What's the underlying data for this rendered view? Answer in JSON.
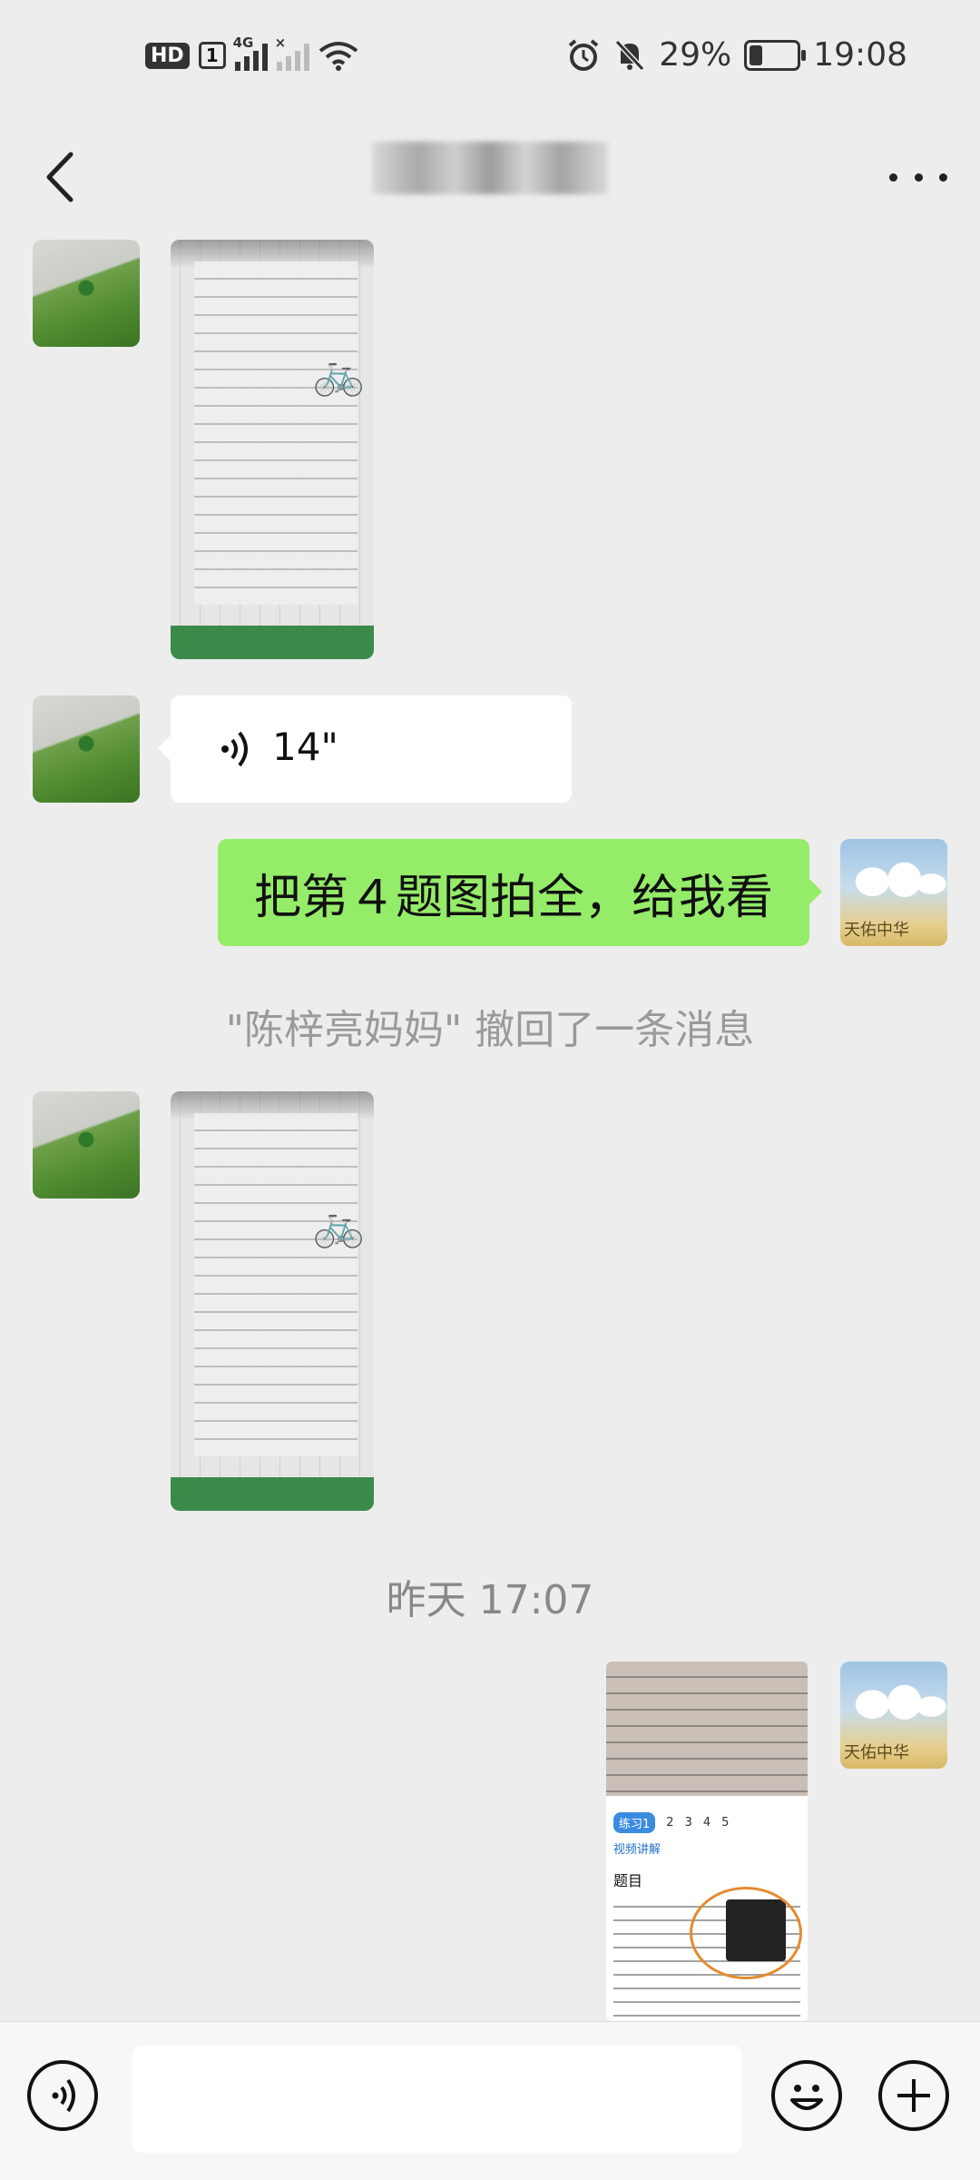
{
  "status_bar": {
    "left": {
      "hd": "HD",
      "sim": "1",
      "network": "4G",
      "signal_label_2": "×"
    },
    "battery_percent": "29%",
    "battery_level": 0.29,
    "time": "19:08"
  },
  "navbar": {
    "back_icon": "chevron-left-icon",
    "more_icon": "ellipsis-icon"
  },
  "messages": {
    "voice_duration": "14\"",
    "sent_text": "把第４题图拍全，给我看",
    "recall_notice": "\"陈梓亮妈妈\" 撤回了一条消息",
    "timestamp": "昨天 17:07"
  },
  "screenshot_message": {
    "tabs": [
      "练习1",
      "2",
      "3",
      "4",
      "5"
    ],
    "video_label": "视频讲解",
    "section_title": "题目"
  },
  "input_bar": {
    "voice_icon": "voice-input-icon",
    "emoji_icon": "emoji-icon",
    "plus_icon": "plus-icon"
  }
}
